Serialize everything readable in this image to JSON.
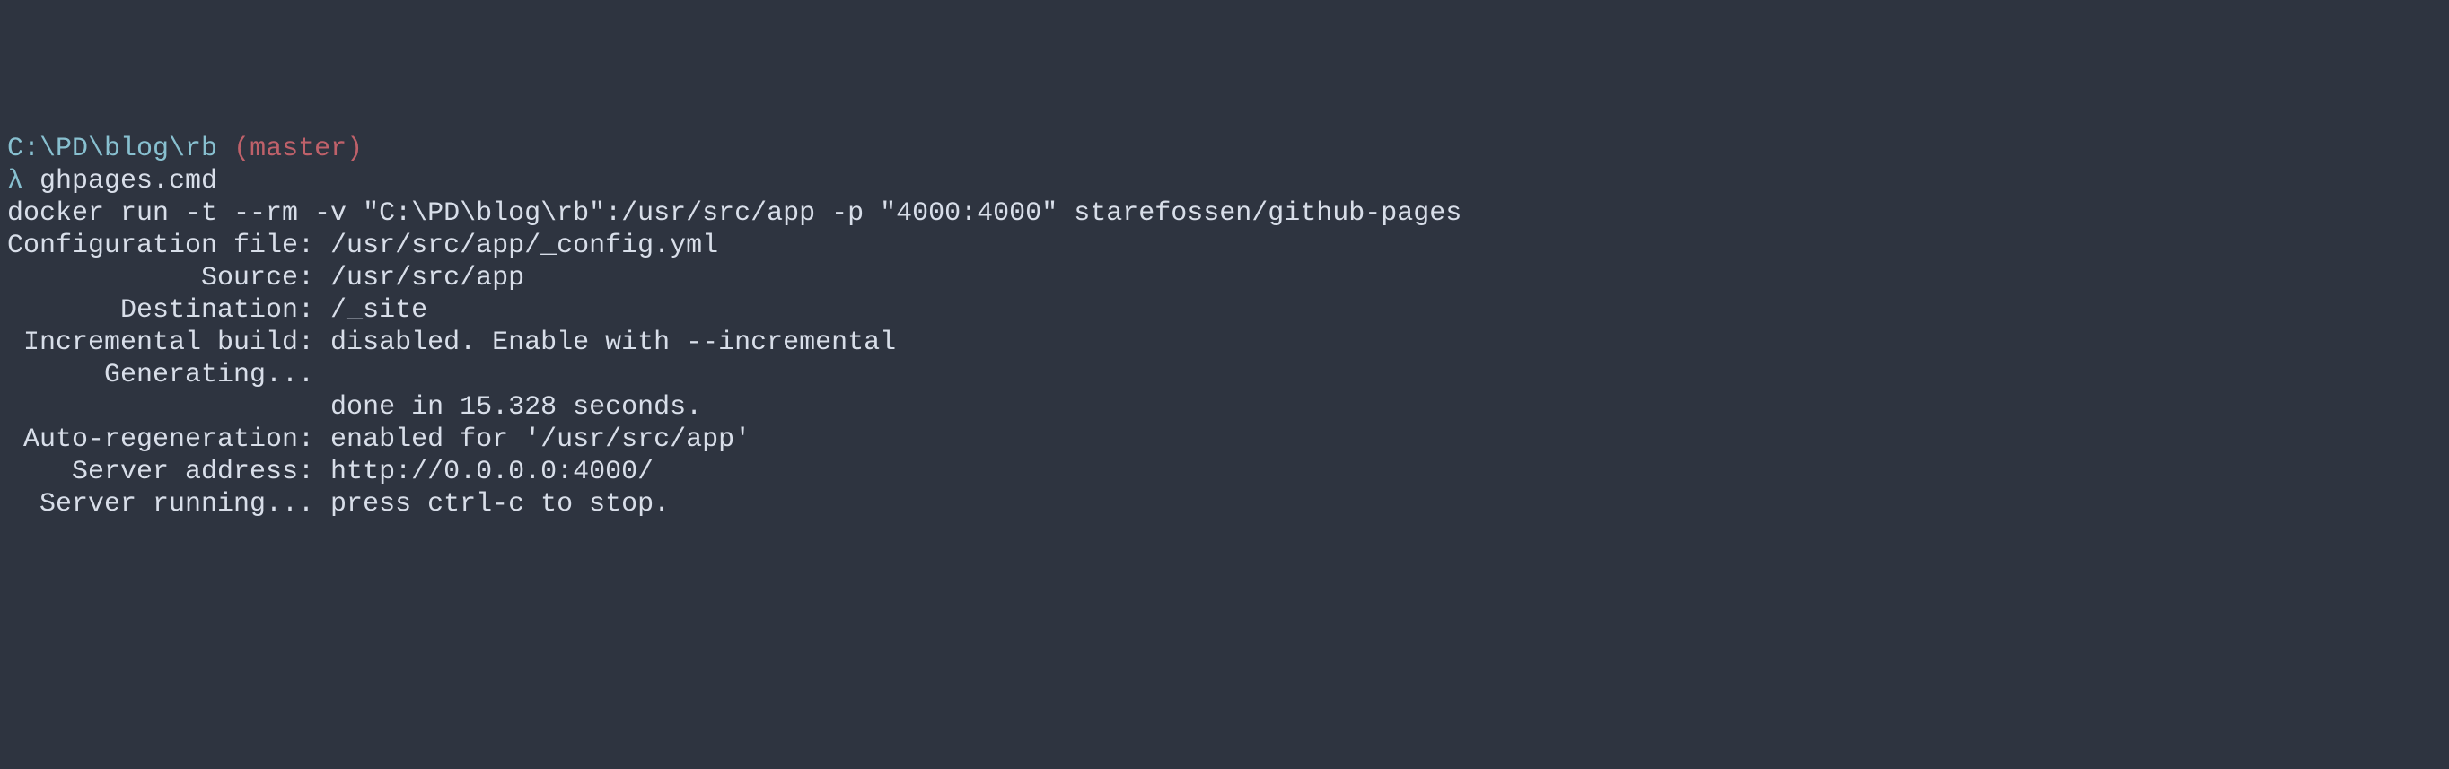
{
  "prompt": {
    "path": "C:\\PD\\blog\\rb",
    "branch": "(master)",
    "symbol": "λ",
    "command": "ghpages.cmd"
  },
  "output": {
    "blank1": "",
    "docker_cmd": "docker run -t --rm -v \"C:\\PD\\blog\\rb\":/usr/src/app -p \"4000:4000\" starefossen/github-pages",
    "config": "Configuration file: /usr/src/app/_config.yml",
    "source": "            Source: /usr/src/app",
    "destination": "       Destination: /_site",
    "incremental": " Incremental build: disabled. Enable with --incremental",
    "generating": "      Generating...",
    "done": "                    done in 15.328 seconds.",
    "autoregen": " Auto-regeneration: enabled for '/usr/src/app'",
    "server_addr": "    Server address: http://0.0.0.0:4000/",
    "server_running": "  Server running... press ctrl-c to stop."
  }
}
